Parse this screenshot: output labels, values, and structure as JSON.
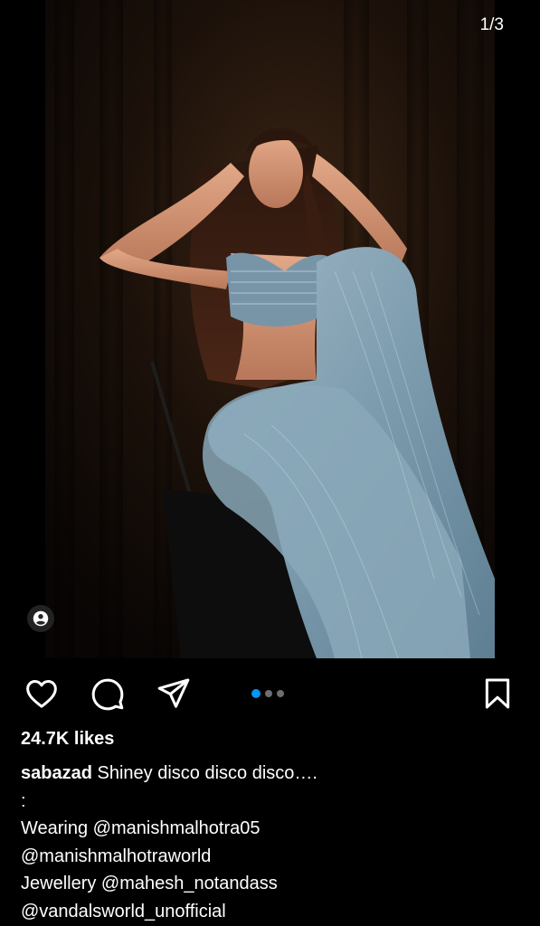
{
  "post": {
    "slide_counter": "1/3",
    "carousel": {
      "total": 3,
      "active_index": 0
    },
    "likes": "24.7K likes",
    "caption": {
      "username": "sabazad",
      "text": "Shiney disco disco disco….",
      "lines": [
        ":",
        "Wearing @manishmalhotra05",
        "@manishmalhotraworld",
        "Jewellery @mahesh_notandass",
        "@vandalsworld_unofficial"
      ]
    }
  },
  "icons": {
    "tag": "person-tag-icon",
    "like": "heart-icon",
    "comment": "comment-bubble-icon",
    "share": "paper-plane-icon",
    "save": "bookmark-icon"
  },
  "colors": {
    "background": "#000000",
    "text": "#ffffff",
    "active_dot": "#0095f6",
    "inactive_dot": "#6e6e6e"
  }
}
